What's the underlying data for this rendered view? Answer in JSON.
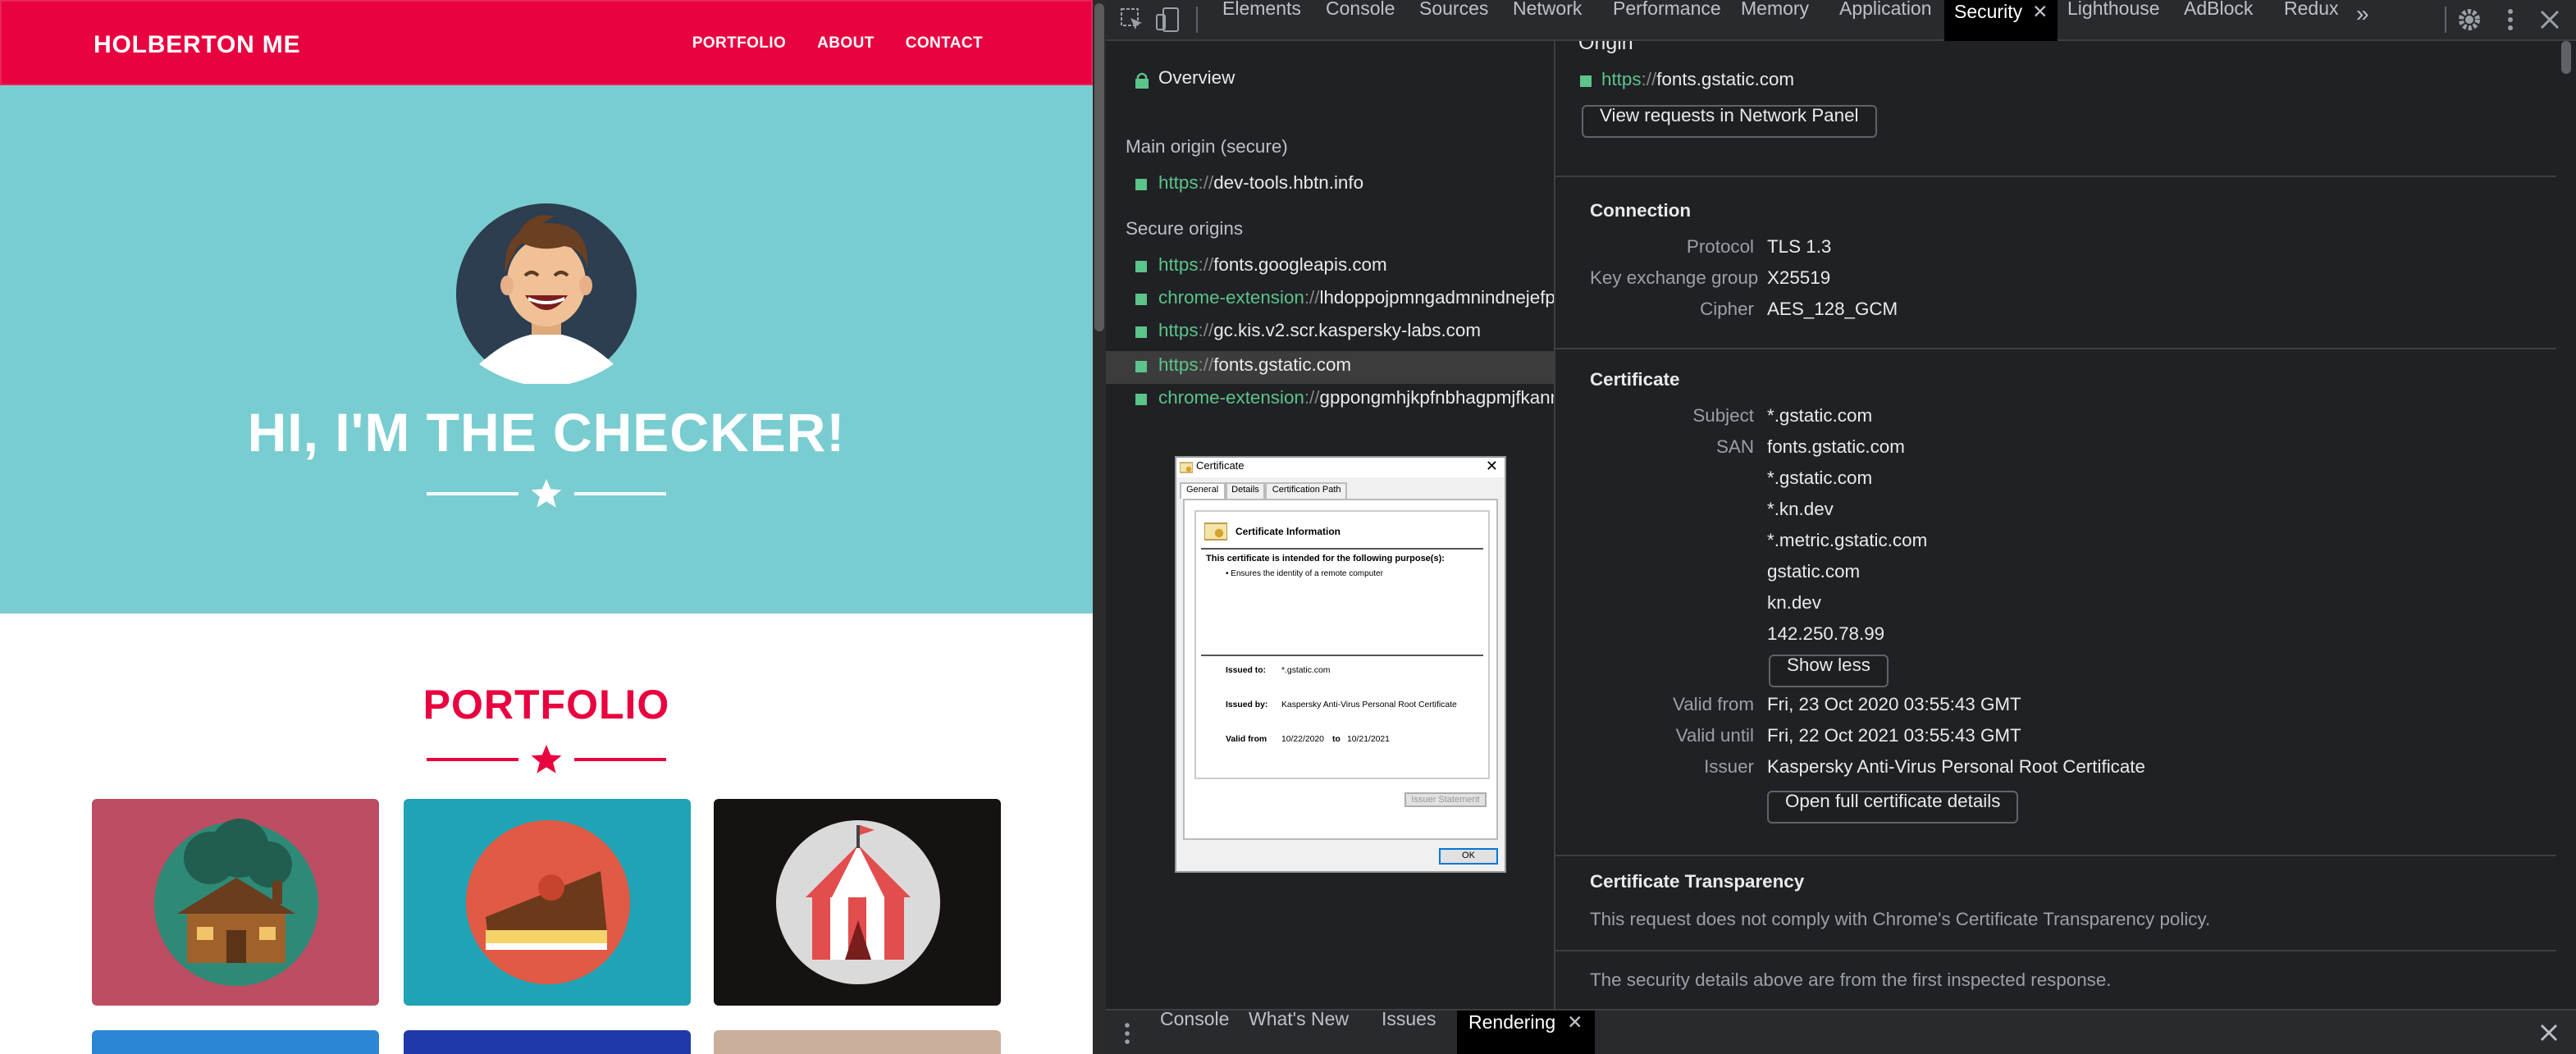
{
  "site": {
    "brand": "HOLBERTON ME",
    "nav": [
      "PORTFOLIO",
      "ABOUT",
      "CONTACT"
    ],
    "hero_title": "HI, I'M THE CHECKER!",
    "portfolio_title": "PORTFOLIO",
    "colors": {
      "brand": "#e8023f",
      "hero": "#79cdd1"
    }
  },
  "devtools": {
    "tabs": [
      "Elements",
      "Console",
      "Sources",
      "Network",
      "Performance",
      "Memory",
      "Application",
      "Security",
      "Lighthouse",
      "AdBlock",
      "Redux"
    ],
    "active_tab": "Security",
    "more_tabs_glyph": "»",
    "sidebar": {
      "overview": "Overview",
      "main_origin_heading": "Main origin (secure)",
      "main_origin": {
        "scheme": "https",
        "sep": "://",
        "host": "dev-tools.hbtn.info"
      },
      "secure_origins_heading": "Secure origins",
      "origins": [
        {
          "scheme": "https",
          "sep": "://",
          "host": "fonts.googleapis.com"
        },
        {
          "scheme": "chrome-extension",
          "sep": "://",
          "host": "lhdoppojpmngadmnindnejefpol"
        },
        {
          "scheme": "https",
          "sep": "://",
          "host": "gc.kis.v2.scr.kaspersky-labs.com"
        },
        {
          "scheme": "https",
          "sep": "://",
          "host": "fonts.gstatic.com"
        },
        {
          "scheme": "chrome-extension",
          "sep": "://",
          "host": "gppongmhjkpfnbhagpmjfkannfl"
        }
      ]
    },
    "certificate_dialog": {
      "title": "Certificate",
      "tabs": [
        "General",
        "Details",
        "Certification Path"
      ],
      "info_heading": "Certificate Information",
      "purpose_heading": "This certificate is intended for the following purpose(s):",
      "purpose": "• Ensures the identity of a remote computer",
      "issued_to_label": "Issued to:",
      "issued_to": "*.gstatic.com",
      "issued_by_label": "Issued by:",
      "issued_by": "Kaspersky Anti-Virus Personal Root Certificate",
      "valid_from_label": "Valid from",
      "valid_from": "10/22/2020",
      "to_label": "to",
      "valid_to": "10/21/2021",
      "issuer_statement": "Issuer Statement",
      "ok": "OK"
    },
    "details": {
      "origin_heading": "Origin",
      "origin": {
        "scheme": "https",
        "sep": "://",
        "host": "fonts.gstatic.com"
      },
      "view_requests": "View requests in Network Panel",
      "connection_heading": "Connection",
      "connection": [
        {
          "label": "Protocol",
          "value": "TLS 1.3"
        },
        {
          "label": "Key exchange group",
          "value": "X25519"
        },
        {
          "label": "Cipher",
          "value": "AES_128_GCM"
        }
      ],
      "certificate_heading": "Certificate",
      "subject_label": "Subject",
      "subject": "*.gstatic.com",
      "san_label": "SAN",
      "san": [
        "fonts.gstatic.com",
        "*.gstatic.com",
        "*.kn.dev",
        "*.metric.gstatic.com",
        "gstatic.com",
        "kn.dev",
        "142.250.78.99"
      ],
      "show_less": "Show less",
      "valid_from_label": "Valid from",
      "valid_from": "Fri, 23 Oct 2020 03:55:43 GMT",
      "valid_until_label": "Valid until",
      "valid_until": "Fri, 22 Oct 2021 03:55:43 GMT",
      "issuer_label": "Issuer",
      "issuer": "Kaspersky Anti-Virus Personal Root Certificate",
      "open_cert": "Open full certificate details",
      "ct_heading": "Certificate Transparency",
      "ct_text": "This request does not comply with Chrome's Certificate Transparency policy.",
      "footer_note": "The security details above are from the first inspected response."
    },
    "drawer": {
      "tabs": [
        "Console",
        "What's New",
        "Issues",
        "Rendering"
      ],
      "active": "Rendering"
    }
  }
}
